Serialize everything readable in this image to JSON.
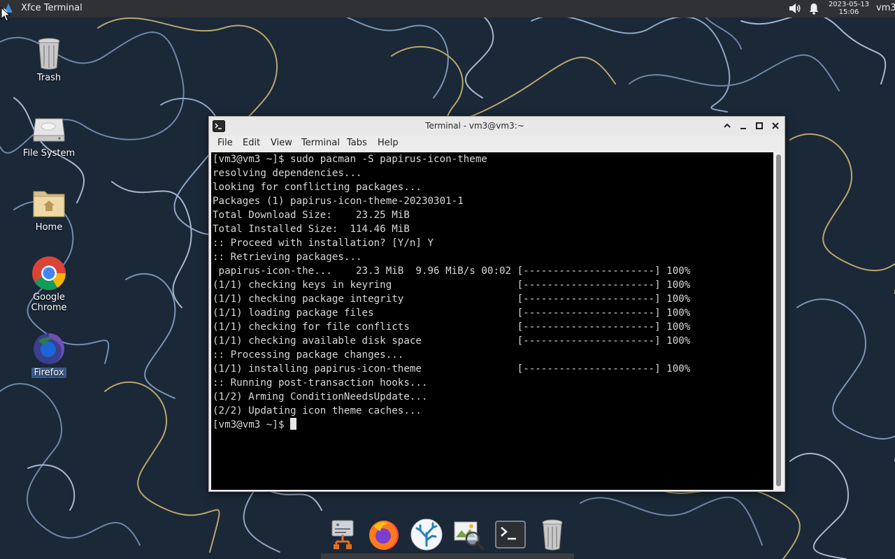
{
  "top_panel": {
    "active_window_title": "Xfce Terminal",
    "clock_date": "2023-05-13",
    "clock_time": "15:06",
    "user": "vm3"
  },
  "desktop_icons": [
    {
      "label": "Trash",
      "icon": "trash-icon"
    },
    {
      "label": "File System",
      "icon": "drive-icon"
    },
    {
      "label": "Home",
      "icon": "home-folder-icon"
    },
    {
      "label": "Google Chrome",
      "icon": "chrome-icon"
    },
    {
      "label": "Firefox",
      "icon": "firefox-icon",
      "selected": true
    }
  ],
  "terminal": {
    "title": "Terminal - vm3@vm3:~",
    "menu": [
      "File",
      "Edit",
      "View",
      "Terminal",
      "Tabs",
      "Help"
    ],
    "lines": [
      "[vm3@vm3 ~]$ sudo pacman -S papirus-icon-theme",
      "resolving dependencies...",
      "looking for conflicting packages...",
      "",
      "Packages (1) papirus-icon-theme-20230301-1",
      "",
      "Total Download Size:    23.25 MiB",
      "Total Installed Size:  114.46 MiB",
      "",
      ":: Proceed with installation? [Y/n] Y",
      ":: Retrieving packages...",
      " papirus-icon-the...    23.3 MiB  9.96 MiB/s 00:02 [----------------------] 100%",
      "(1/1) checking keys in keyring                     [----------------------] 100%",
      "(1/1) checking package integrity                   [----------------------] 100%",
      "(1/1) loading package files                        [----------------------] 100%",
      "(1/1) checking for file conflicts                  [----------------------] 100%",
      "(1/1) checking available disk space                [----------------------] 100%",
      ":: Processing package changes...",
      "(1/1) installing papirus-icon-theme                [----------------------] 100%",
      ":: Running post-transaction hooks...",
      "(1/2) Arming ConditionNeedsUpdate...",
      "(2/2) Updating icon theme caches..."
    ],
    "prompt": "[vm3@vm3 ~]$ "
  },
  "dock": {
    "items": [
      "network-settings-icon",
      "firefox-icon",
      "coral-app-icon",
      "image-viewer-icon",
      "terminal-icon",
      "trash-icon"
    ]
  },
  "colors": {
    "panel": "#2f3134",
    "terminal_bg": "#000000",
    "terminal_fg": "#d8d8d8",
    "selection": "#3a5a8c"
  }
}
